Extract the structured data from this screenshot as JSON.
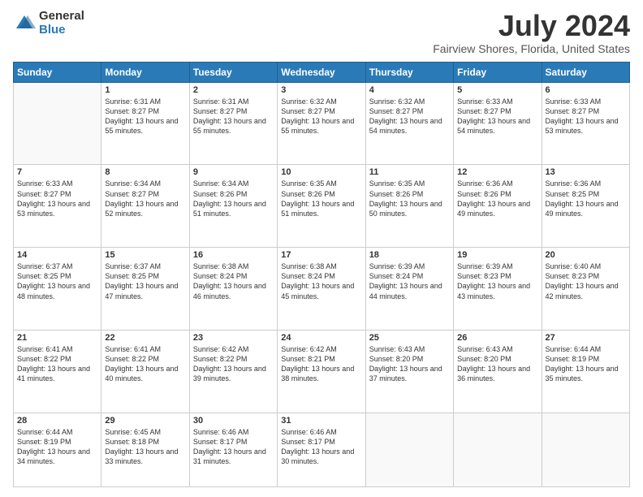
{
  "logo": {
    "general": "General",
    "blue": "Blue"
  },
  "title": "July 2024",
  "subtitle": "Fairview Shores, Florida, United States",
  "days": [
    "Sunday",
    "Monday",
    "Tuesday",
    "Wednesday",
    "Thursday",
    "Friday",
    "Saturday"
  ],
  "weeks": [
    [
      {
        "num": "",
        "sr": "",
        "ss": "",
        "dl": ""
      },
      {
        "num": "1",
        "sr": "Sunrise: 6:31 AM",
        "ss": "Sunset: 8:27 PM",
        "dl": "Daylight: 13 hours and 55 minutes."
      },
      {
        "num": "2",
        "sr": "Sunrise: 6:31 AM",
        "ss": "Sunset: 8:27 PM",
        "dl": "Daylight: 13 hours and 55 minutes."
      },
      {
        "num": "3",
        "sr": "Sunrise: 6:32 AM",
        "ss": "Sunset: 8:27 PM",
        "dl": "Daylight: 13 hours and 55 minutes."
      },
      {
        "num": "4",
        "sr": "Sunrise: 6:32 AM",
        "ss": "Sunset: 8:27 PM",
        "dl": "Daylight: 13 hours and 54 minutes."
      },
      {
        "num": "5",
        "sr": "Sunrise: 6:33 AM",
        "ss": "Sunset: 8:27 PM",
        "dl": "Daylight: 13 hours and 54 minutes."
      },
      {
        "num": "6",
        "sr": "Sunrise: 6:33 AM",
        "ss": "Sunset: 8:27 PM",
        "dl": "Daylight: 13 hours and 53 minutes."
      }
    ],
    [
      {
        "num": "7",
        "sr": "Sunrise: 6:33 AM",
        "ss": "Sunset: 8:27 PM",
        "dl": "Daylight: 13 hours and 53 minutes."
      },
      {
        "num": "8",
        "sr": "Sunrise: 6:34 AM",
        "ss": "Sunset: 8:27 PM",
        "dl": "Daylight: 13 hours and 52 minutes."
      },
      {
        "num": "9",
        "sr": "Sunrise: 6:34 AM",
        "ss": "Sunset: 8:26 PM",
        "dl": "Daylight: 13 hours and 51 minutes."
      },
      {
        "num": "10",
        "sr": "Sunrise: 6:35 AM",
        "ss": "Sunset: 8:26 PM",
        "dl": "Daylight: 13 hours and 51 minutes."
      },
      {
        "num": "11",
        "sr": "Sunrise: 6:35 AM",
        "ss": "Sunset: 8:26 PM",
        "dl": "Daylight: 13 hours and 50 minutes."
      },
      {
        "num": "12",
        "sr": "Sunrise: 6:36 AM",
        "ss": "Sunset: 8:26 PM",
        "dl": "Daylight: 13 hours and 49 minutes."
      },
      {
        "num": "13",
        "sr": "Sunrise: 6:36 AM",
        "ss": "Sunset: 8:25 PM",
        "dl": "Daylight: 13 hours and 49 minutes."
      }
    ],
    [
      {
        "num": "14",
        "sr": "Sunrise: 6:37 AM",
        "ss": "Sunset: 8:25 PM",
        "dl": "Daylight: 13 hours and 48 minutes."
      },
      {
        "num": "15",
        "sr": "Sunrise: 6:37 AM",
        "ss": "Sunset: 8:25 PM",
        "dl": "Daylight: 13 hours and 47 minutes."
      },
      {
        "num": "16",
        "sr": "Sunrise: 6:38 AM",
        "ss": "Sunset: 8:24 PM",
        "dl": "Daylight: 13 hours and 46 minutes."
      },
      {
        "num": "17",
        "sr": "Sunrise: 6:38 AM",
        "ss": "Sunset: 8:24 PM",
        "dl": "Daylight: 13 hours and 45 minutes."
      },
      {
        "num": "18",
        "sr": "Sunrise: 6:39 AM",
        "ss": "Sunset: 8:24 PM",
        "dl": "Daylight: 13 hours and 44 minutes."
      },
      {
        "num": "19",
        "sr": "Sunrise: 6:39 AM",
        "ss": "Sunset: 8:23 PM",
        "dl": "Daylight: 13 hours and 43 minutes."
      },
      {
        "num": "20",
        "sr": "Sunrise: 6:40 AM",
        "ss": "Sunset: 8:23 PM",
        "dl": "Daylight: 13 hours and 42 minutes."
      }
    ],
    [
      {
        "num": "21",
        "sr": "Sunrise: 6:41 AM",
        "ss": "Sunset: 8:22 PM",
        "dl": "Daylight: 13 hours and 41 minutes."
      },
      {
        "num": "22",
        "sr": "Sunrise: 6:41 AM",
        "ss": "Sunset: 8:22 PM",
        "dl": "Daylight: 13 hours and 40 minutes."
      },
      {
        "num": "23",
        "sr": "Sunrise: 6:42 AM",
        "ss": "Sunset: 8:22 PM",
        "dl": "Daylight: 13 hours and 39 minutes."
      },
      {
        "num": "24",
        "sr": "Sunrise: 6:42 AM",
        "ss": "Sunset: 8:21 PM",
        "dl": "Daylight: 13 hours and 38 minutes."
      },
      {
        "num": "25",
        "sr": "Sunrise: 6:43 AM",
        "ss": "Sunset: 8:20 PM",
        "dl": "Daylight: 13 hours and 37 minutes."
      },
      {
        "num": "26",
        "sr": "Sunrise: 6:43 AM",
        "ss": "Sunset: 8:20 PM",
        "dl": "Daylight: 13 hours and 36 minutes."
      },
      {
        "num": "27",
        "sr": "Sunrise: 6:44 AM",
        "ss": "Sunset: 8:19 PM",
        "dl": "Daylight: 13 hours and 35 minutes."
      }
    ],
    [
      {
        "num": "28",
        "sr": "Sunrise: 6:44 AM",
        "ss": "Sunset: 8:19 PM",
        "dl": "Daylight: 13 hours and 34 minutes."
      },
      {
        "num": "29",
        "sr": "Sunrise: 6:45 AM",
        "ss": "Sunset: 8:18 PM",
        "dl": "Daylight: 13 hours and 33 minutes."
      },
      {
        "num": "30",
        "sr": "Sunrise: 6:46 AM",
        "ss": "Sunset: 8:17 PM",
        "dl": "Daylight: 13 hours and 31 minutes."
      },
      {
        "num": "31",
        "sr": "Sunrise: 6:46 AM",
        "ss": "Sunset: 8:17 PM",
        "dl": "Daylight: 13 hours and 30 minutes."
      },
      {
        "num": "",
        "sr": "",
        "ss": "",
        "dl": ""
      },
      {
        "num": "",
        "sr": "",
        "ss": "",
        "dl": ""
      },
      {
        "num": "",
        "sr": "",
        "ss": "",
        "dl": ""
      }
    ]
  ]
}
